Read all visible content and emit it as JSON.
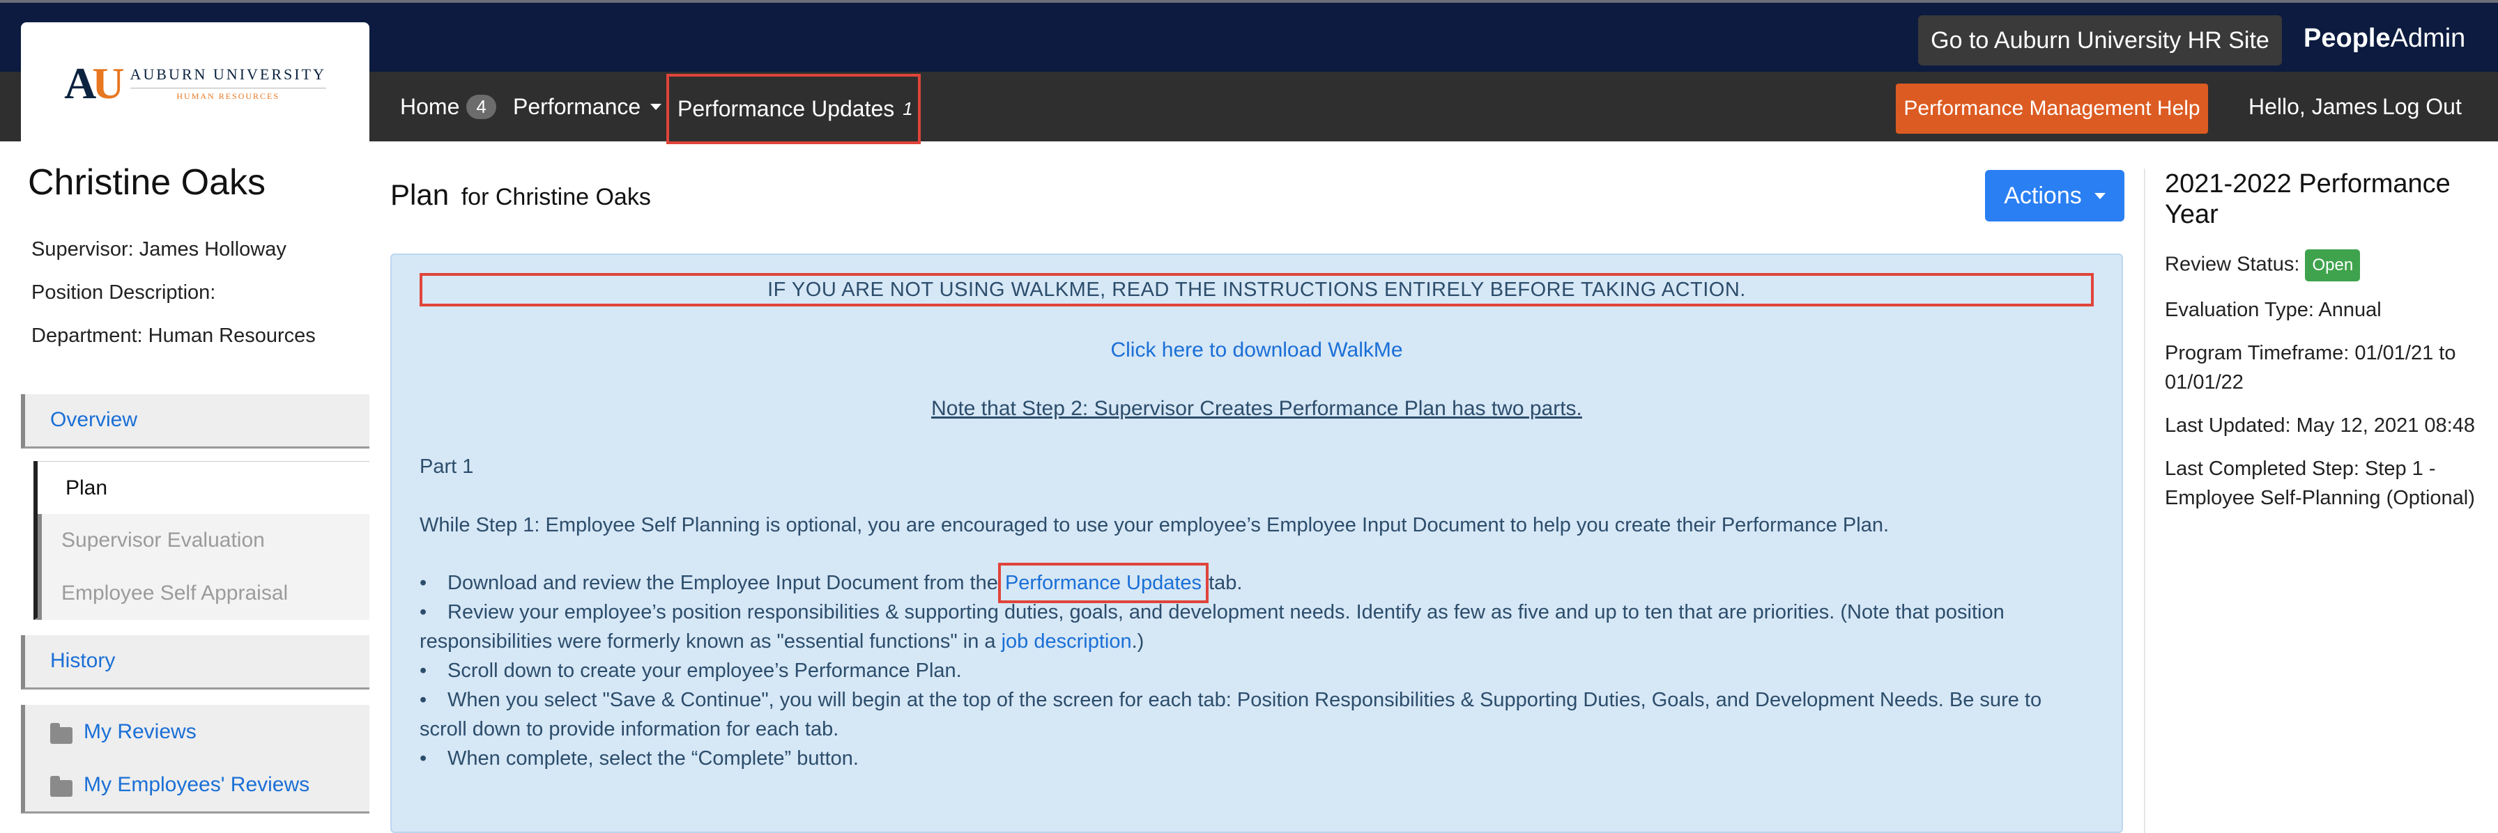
{
  "header": {
    "hr_site_button": "Go to Auburn University HR Site",
    "brand_bold": "People",
    "brand_rest": "Admin",
    "logo_title": "AUBURN UNIVERSITY",
    "logo_subtitle": "HUMAN RESOURCES"
  },
  "nav": {
    "home_label": "Home",
    "home_badge": "4",
    "performance_label": "Performance",
    "updates_label": "Performance Updates",
    "updates_count": "1",
    "help_button": "Performance Management Help",
    "greeting": "Hello, James",
    "logout": "Log Out"
  },
  "profile": {
    "name": "Christine Oaks",
    "supervisor": "Supervisor: James Holloway",
    "position": "Position Description:",
    "department": "Department: Human Resources"
  },
  "sidebar": {
    "overview": "Overview",
    "plan": "Plan",
    "supervisor_eval": "Supervisor Evaluation",
    "self_appraisal": "Employee Self Appraisal",
    "history": "History",
    "my_reviews": "My Reviews",
    "my_employees_reviews": "My Employees' Reviews"
  },
  "main": {
    "title": "Plan",
    "title_suffix": "for Christine Oaks",
    "actions_button": "Actions",
    "warning": "IF YOU ARE NOT USING WALKME, READ THE INSTRUCTIONS ENTIRELY BEFORE TAKING ACTION.",
    "walkme_link": "Click here to download WalkMe",
    "note": "Note that Step 2: Supervisor Creates Performance Plan has two parts.",
    "part_label": "Part 1",
    "intro": "While Step 1: Employee Self Planning is optional, you are encouraged to use your employee’s Employee Input Document to help you create their Performance Plan.",
    "b1_pre": "Download and review the Employee Input Document from the ",
    "b1_link": "Performance Updates",
    "b1_post": " tab.",
    "b2_line1": "Review your employee’s position responsibilities & supporting duties, goals, and development needs. Identify as few as five and up to ten that are priorities. (Note that position",
    "b2_line2_pre": "responsibilities were formerly known as \"essential functions\" in a ",
    "b2_link": "job description",
    "b2_line2_post": ".)",
    "b3": "Scroll down to create your employee’s Performance Plan.",
    "b4_line1": "When you select \"Save & Continue\", you will begin at the top of the screen for each tab: Position Responsibilities & Supporting Duties, Goals, and Development Needs. Be sure to",
    "b4_line2": "scroll down to provide information for each tab.",
    "b5": "When complete, select the “Complete” button."
  },
  "review": {
    "year_title": "2021-2022 Performance Year",
    "status_label": "Review Status:",
    "status_value": "Open",
    "eval_type": "Evaluation Type: Annual",
    "timeframe": "Program Timeframe: 01/01/21 to 01/01/22",
    "last_updated": "Last Updated: May 12, 2021 08:48",
    "last_step": "Last Completed Step: Step 1 - Employee Self-Planning (Optional)"
  },
  "colors": {
    "top_bar": "#0c1b3f",
    "nav_bar": "#2f2f2f",
    "help_orange": "#dc5b22",
    "actions_blue": "#2a7ff3",
    "panel_blue": "#d6e7f6",
    "highlight_red": "#e0443a",
    "open_green": "#3fa34d"
  }
}
